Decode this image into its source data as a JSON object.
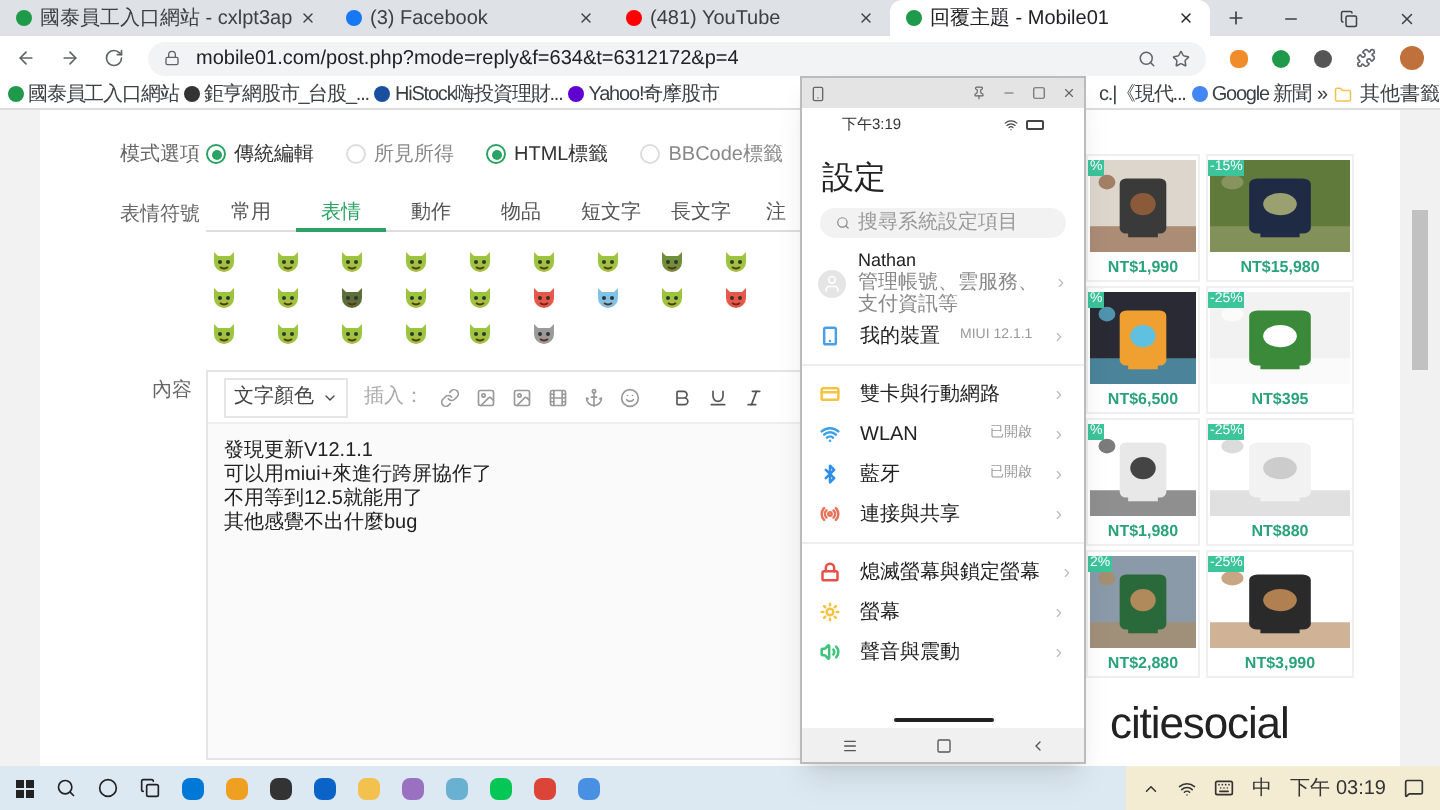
{
  "browser": {
    "tabs": [
      {
        "title": "國泰員工入口網站 - cxlpt3ap",
        "selected": false
      },
      {
        "title": "(3) Facebook",
        "selected": false
      },
      {
        "title": "(481) YouTube",
        "selected": false
      },
      {
        "title": "回覆主題 - Mobile01",
        "selected": true
      }
    ],
    "address": "mobile01.com/post.php?mode=reply&f=634&t=6312172&p=4",
    "bookmarks": [
      "國泰員工入口網站",
      "鉅亨網股市_台股_...",
      "HiStock嗨投資理財...",
      "Yahoo!奇摩股市"
    ],
    "bookmarks_right": [
      "c.|《現代...",
      "Google 新聞"
    ],
    "more": "»",
    "other_bookmarks": "其他書籤"
  },
  "form": {
    "mode_label": "模式選項",
    "modes": [
      {
        "label": "傳統編輯",
        "selected": true
      },
      {
        "label": "所見所得",
        "selected": false
      },
      {
        "label": "HTML標籤",
        "selected": true
      },
      {
        "label": "BBCode標籤",
        "selected": false
      }
    ],
    "emoji_label": "表情符號",
    "emoji_tabs": [
      {
        "label": "常用",
        "selected": false
      },
      {
        "label": "表情",
        "selected": true
      },
      {
        "label": "動作",
        "selected": false
      },
      {
        "label": "物品",
        "selected": false
      },
      {
        "label": "短文字",
        "selected": false
      },
      {
        "label": "長文字",
        "selected": false
      },
      {
        "label": "注",
        "selected": false
      }
    ],
    "emoji_rows": [
      [
        {
          "color": "#9cc43c"
        },
        {
          "color": "#9cc43c"
        },
        {
          "color": "#9cc43c"
        },
        {
          "color": "#9cc43c"
        },
        {
          "color": "#9cc43c"
        },
        {
          "color": "#9cc43c"
        },
        {
          "color": "#9cc43c"
        },
        {
          "color": "#6f8f3a"
        },
        {
          "color": "#9cc43c"
        }
      ],
      [
        {
          "color": "#9cc43c"
        },
        {
          "color": "#9cc43c"
        },
        {
          "color": "#5b6f3a"
        },
        {
          "color": "#9cc43c"
        },
        {
          "color": "#9cc43c"
        },
        {
          "color": "#e8584a"
        },
        {
          "color": "#7fc4e8"
        },
        {
          "color": "#9cc43c"
        },
        {
          "color": "#e8584a"
        }
      ],
      [
        {
          "color": "#9cc43c"
        },
        {
          "color": "#9cc43c"
        },
        {
          "color": "#9cc43c"
        },
        {
          "color": "#9cc43c"
        },
        {
          "color": "#9cc43c"
        },
        {
          "color": "#9a9a9a"
        }
      ]
    ],
    "content_label": "內容",
    "text_color": "文字顏色",
    "insert": "插入：",
    "content_lines": [
      "發現更新V12.1.1",
      "可以用miui+來進行跨屏協作了",
      "不用等到12.5就能用了",
      "其他感覺不出什麼bug"
    ]
  },
  "phone": {
    "time": "下午3:19",
    "title": "設定",
    "search_placeholder": "搜尋系統設定項目",
    "account": {
      "name": "Nathan",
      "detail": "管理帳號、雲服務、支付資訊等"
    },
    "groups": [
      [
        {
          "kind": "device",
          "label": "我的裝置",
          "value": "MIUI 12.1.1",
          "color": "#4aa0e8"
        }
      ],
      [
        {
          "kind": "sim",
          "label": "雙卡與行動網路",
          "color": "#f5c242"
        },
        {
          "kind": "wifi",
          "label": "WLAN",
          "value": "已開啟",
          "color": "#3aa0e8"
        },
        {
          "kind": "bluetooth",
          "label": "藍牙",
          "value": "已開啟",
          "color": "#2f8fe8"
        },
        {
          "kind": "share",
          "label": "連接與共享",
          "color": "#e8735a"
        }
      ],
      [
        {
          "kind": "lock",
          "label": "熄滅螢幕與鎖定螢幕",
          "color": "#e8504a"
        },
        {
          "kind": "display",
          "label": "螢幕",
          "color": "#f5c242"
        },
        {
          "kind": "sound",
          "label": "聲音與震動",
          "color": "#3cc47a"
        }
      ]
    ]
  },
  "ads": {
    "items": [
      {
        "badge": "%",
        "price": "NT$1,990"
      },
      {
        "badge": "-15%",
        "price": "NT$15,980"
      },
      {
        "badge": "%",
        "price": "NT$6,500"
      },
      {
        "badge": "-25%",
        "price": "NT$395"
      },
      {
        "badge": "%",
        "price": "NT$1,980"
      },
      {
        "badge": "-25%",
        "price": "NT$880"
      },
      {
        "badge": "2%",
        "price": "NT$2,880"
      },
      {
        "badge": "-25%",
        "price": "NT$3,990"
      }
    ],
    "brand": "citiesocial"
  },
  "taskbar": {
    "ime": "中",
    "time": "下午 03:19"
  }
}
